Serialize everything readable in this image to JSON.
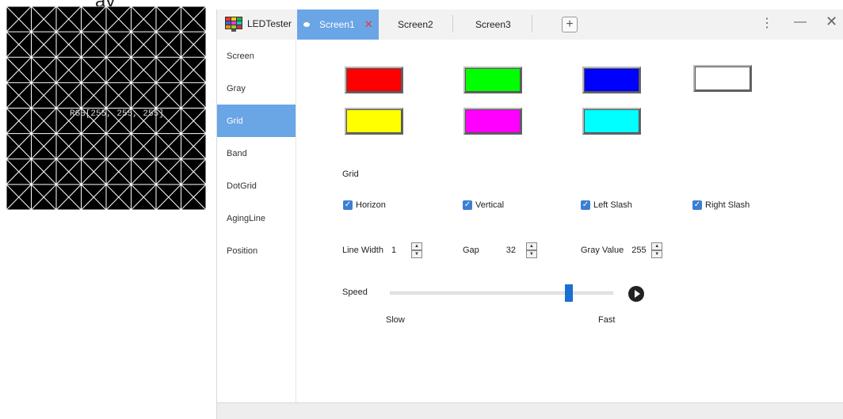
{
  "preview": {
    "heading_fragment": "ay",
    "rgb_text": "RGB[255, 255, 255]"
  },
  "app": {
    "name": "LEDTester",
    "tabs": [
      {
        "label": "Screen1",
        "active": true
      },
      {
        "label": "Screen2",
        "active": false
      },
      {
        "label": "Screen3",
        "active": false
      }
    ],
    "add_tab_label": "+",
    "menu_label": "⋮",
    "minimize_label": "—",
    "close_label": "✕"
  },
  "sidebar": {
    "items": [
      {
        "label": "Screen"
      },
      {
        "label": "Gray"
      },
      {
        "label": "Grid",
        "active": true
      },
      {
        "label": "Band"
      },
      {
        "label": "DotGrid"
      },
      {
        "label": "AgingLine"
      },
      {
        "label": "Position"
      }
    ]
  },
  "colors": {
    "swatches": [
      "#ff0000",
      "#00ff00",
      "#0000ff",
      "#ffffff",
      "#ffff00",
      "#ff00ff",
      "#00ffff"
    ],
    "accent": "#6aa5e6"
  },
  "grid": {
    "section_label": "Grid",
    "checkboxes": [
      {
        "label": "Horizon",
        "checked": true
      },
      {
        "label": "Vertical",
        "checked": true
      },
      {
        "label": "Left Slash",
        "checked": true
      },
      {
        "label": "Right Slash",
        "checked": true
      }
    ],
    "line_width": {
      "label": "Line Width",
      "value": "1"
    },
    "gap": {
      "label": "Gap",
      "value": "32"
    },
    "gray_value": {
      "label": "Gray Value",
      "value": "255"
    }
  },
  "speed": {
    "label": "Speed",
    "slow_label": "Slow",
    "fast_label": "Fast",
    "level": 0.8
  }
}
